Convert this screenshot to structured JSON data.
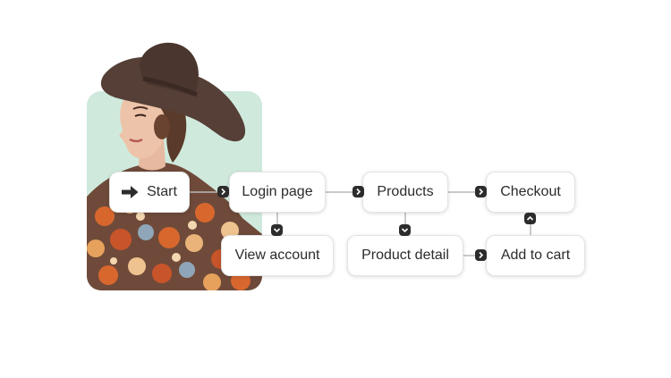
{
  "colors": {
    "card_bg": "#cfeadd",
    "node_bg": "#ffffff",
    "node_border": "#e3e3e3",
    "connector": "#b8b8b8",
    "port": "#2c2c2c",
    "text": "#2c2c2c"
  },
  "nodes": {
    "start": {
      "label": "Start",
      "icon": "arrow-right-icon"
    },
    "login": {
      "label": "Login page"
    },
    "products": {
      "label": "Products"
    },
    "checkout": {
      "label": "Checkout"
    },
    "view_account": {
      "label": "View account"
    },
    "product_detail": {
      "label": "Product detail"
    },
    "add_to_cart": {
      "label": "Add to cart"
    }
  },
  "ports": [
    "chevron-right-icon",
    "chevron-down-icon",
    "chevron-up-icon"
  ]
}
